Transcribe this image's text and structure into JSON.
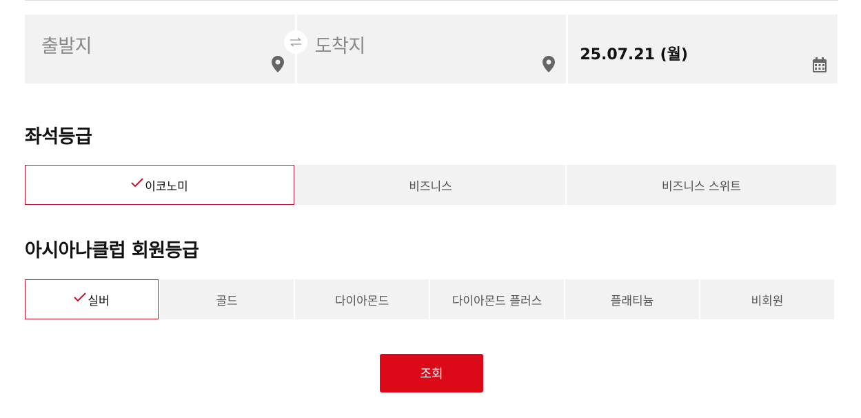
{
  "route": {
    "departure_placeholder": "출발지",
    "arrival_placeholder": "도착지",
    "date_value": "25.07.21 (월)",
    "swap_icon": "swap-arrows-icon",
    "location_icon": "map-pin-icon",
    "calendar_icon": "calendar-icon"
  },
  "seat_class": {
    "title": "좌석등급",
    "options": [
      {
        "label": "이코노미",
        "selected": true
      },
      {
        "label": "비즈니스",
        "selected": false
      },
      {
        "label": "비즈니스 스위트",
        "selected": false
      }
    ]
  },
  "membership": {
    "title": "아시아나클럽 회원등급",
    "options": [
      {
        "label": "실버",
        "selected": true
      },
      {
        "label": "골드",
        "selected": false
      },
      {
        "label": "다이아몬드",
        "selected": false
      },
      {
        "label": "다이아몬드 플러스",
        "selected": false
      },
      {
        "label": "플래티늄",
        "selected": false
      },
      {
        "label": "비회원",
        "selected": false
      }
    ]
  },
  "search_button_label": "조회",
  "colors": {
    "accent": "#dc0a18",
    "selected_border": "#c8102e",
    "field_bg": "#f2f2f2"
  }
}
